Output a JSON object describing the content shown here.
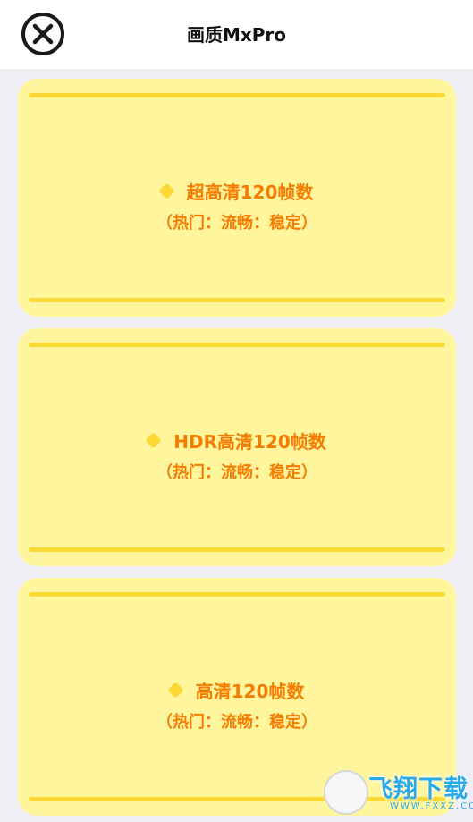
{
  "header": {
    "title": "画质MxPro",
    "close_icon": "close-icon"
  },
  "options": [
    {
      "label": "超高清120帧数",
      "tags": "（热门：流畅：稳定）"
    },
    {
      "label": "HDR高清120帧数",
      "tags": "（热门：流畅：稳定）"
    },
    {
      "label": "高清120帧数",
      "tags": "（热门：流畅：稳定）"
    }
  ],
  "watermark": {
    "text": "飞翔下载",
    "sub": "WWW.FXXZ.COM"
  },
  "colors": {
    "card_bg": "#fff59d",
    "card_bar": "#fdd835",
    "label_text": "#f57c00",
    "page_bg": "#efeef4"
  }
}
